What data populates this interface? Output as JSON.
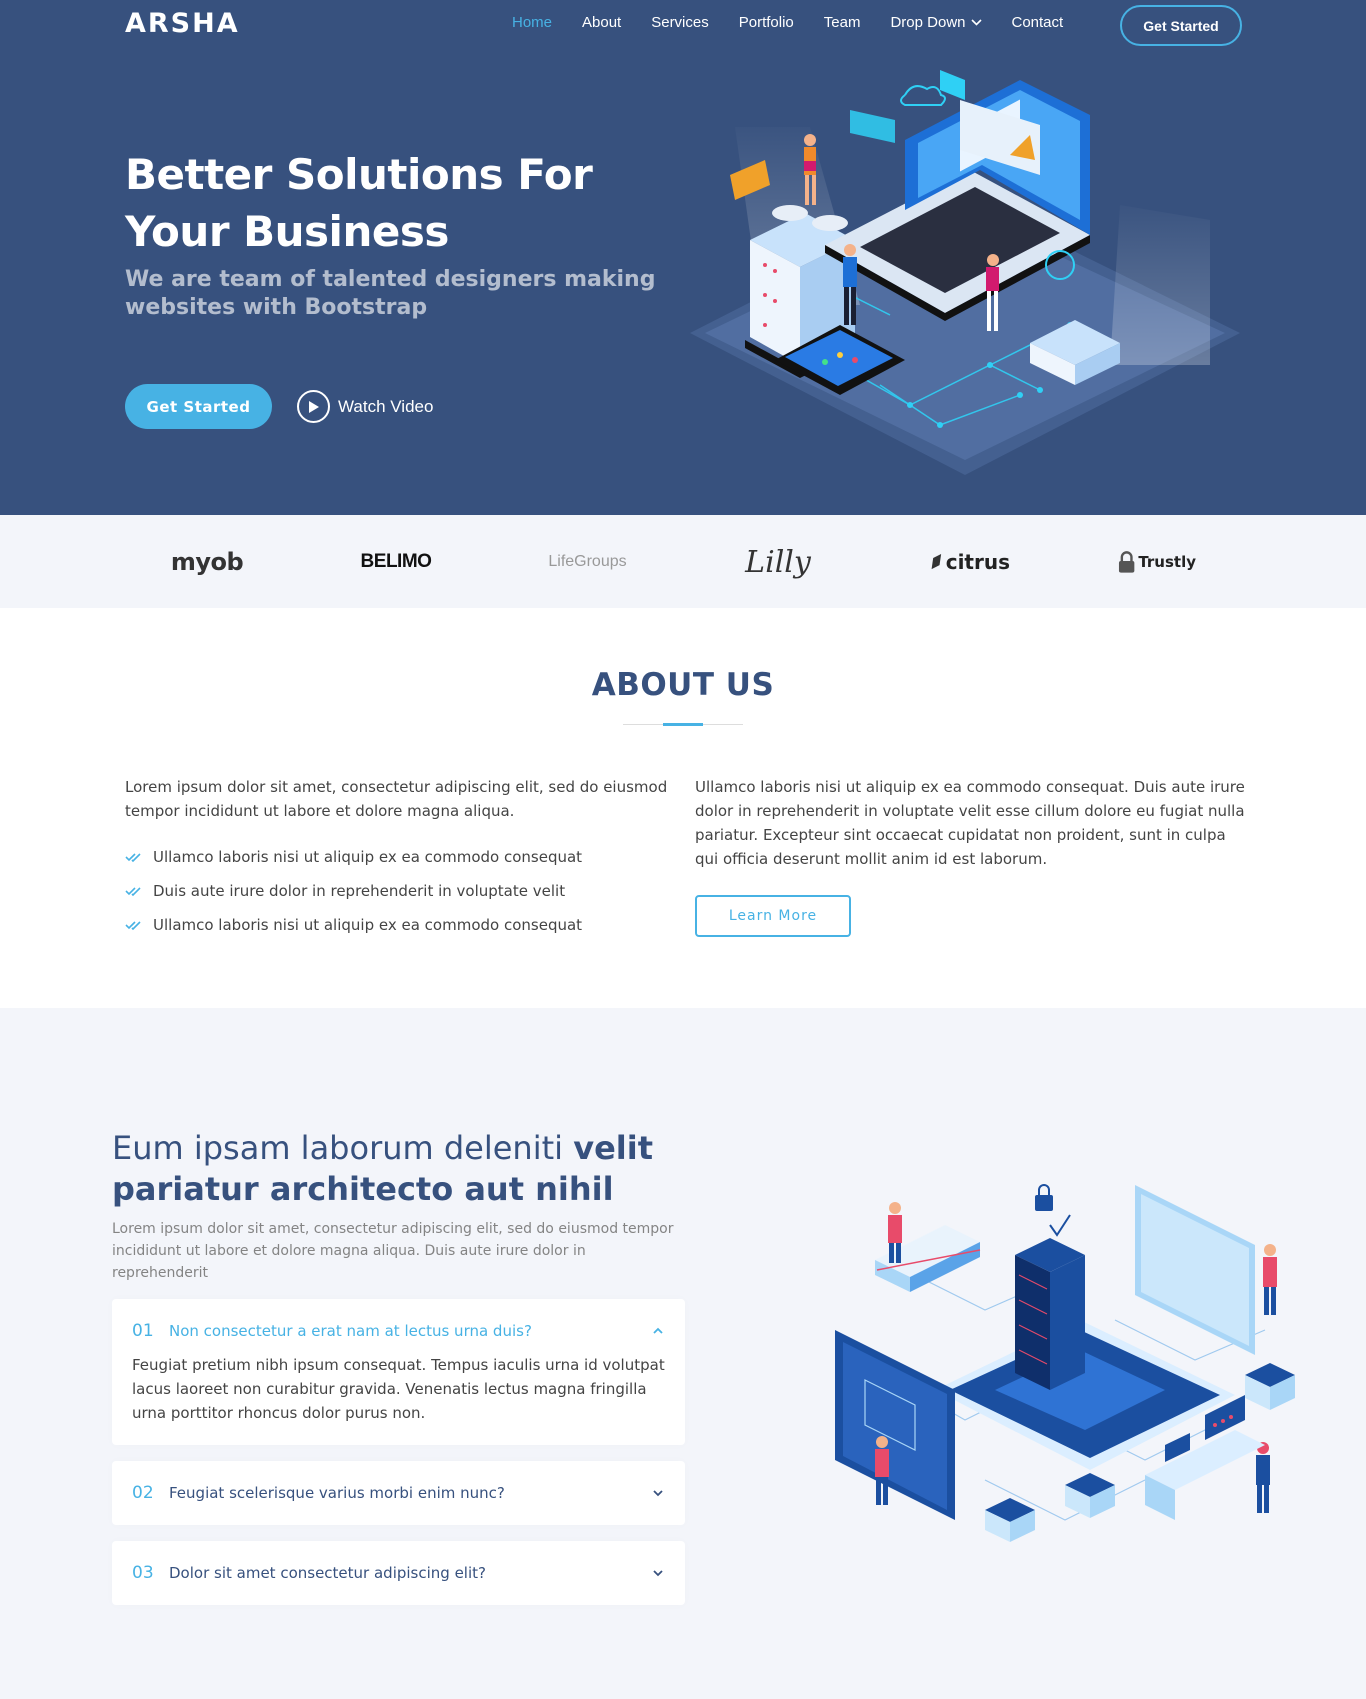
{
  "header": {
    "logo": "ARSHA",
    "nav": [
      {
        "label": "Home",
        "active": true
      },
      {
        "label": "About",
        "active": false
      },
      {
        "label": "Services",
        "active": false
      },
      {
        "label": "Portfolio",
        "active": false
      },
      {
        "label": "Team",
        "active": false
      },
      {
        "label": "Drop Down",
        "active": false,
        "dropdown": true
      },
      {
        "label": "Contact",
        "active": false
      }
    ],
    "cta": "Get Started"
  },
  "hero": {
    "title": "Better Solutions For Your Business",
    "subtitle": "We are team of talented designers making websites with Bootstrap",
    "cta": "Get Started",
    "video": "Watch Video"
  },
  "clients": [
    "myob",
    "BELIMO",
    "LifeGroups",
    "Lilly",
    "citrus",
    "Trustly"
  ],
  "about": {
    "title": "ABOUT US",
    "left_text": "Lorem ipsum dolor sit amet, consectetur adipiscing elit, sed do eiusmod tempor incididunt ut labore et dolore magna aliqua.",
    "list": [
      "Ullamco laboris nisi ut aliquip ex ea commodo consequat",
      "Duis aute irure dolor in reprehenderit in voluptate velit",
      "Ullamco laboris nisi ut aliquip ex ea commodo consequat"
    ],
    "right_text": "Ullamco laboris nisi ut aliquip ex ea commodo consequat. Duis aute irure dolor in reprehenderit in voluptate velit esse cillum dolore eu fugiat nulla pariatur. Excepteur sint occaecat cupidatat non proident, sunt in culpa qui officia deserunt mollit anim id est laborum.",
    "button": "Learn More"
  },
  "why": {
    "title_light": "Eum ipsam laborum deleniti ",
    "title_bold": "velit pariatur architecto aut nihil",
    "description": "Lorem ipsum dolor sit amet, consectetur adipiscing elit, sed do eiusmod tempor incididunt ut labore et dolore magna aliqua. Duis aute irure dolor in reprehenderit",
    "faqs": [
      {
        "num": "01",
        "question": "Non consectetur a erat nam at lectus urna duis?",
        "answer": "Feugiat pretium nibh ipsum consequat. Tempus iaculis urna id volutpat lacus laoreet non curabitur gravida. Venenatis lectus magna fringilla urna porttitor rhoncus dolor purus non.",
        "open": true
      },
      {
        "num": "02",
        "question": "Feugiat scelerisque varius morbi enim nunc?",
        "open": false
      },
      {
        "num": "03",
        "question": "Dolor sit amet consectetur adipiscing elit?",
        "open": false
      }
    ]
  },
  "colors": {
    "primary": "#37517e",
    "accent": "#47b2e4",
    "light_bg": "#f3f5fa"
  }
}
